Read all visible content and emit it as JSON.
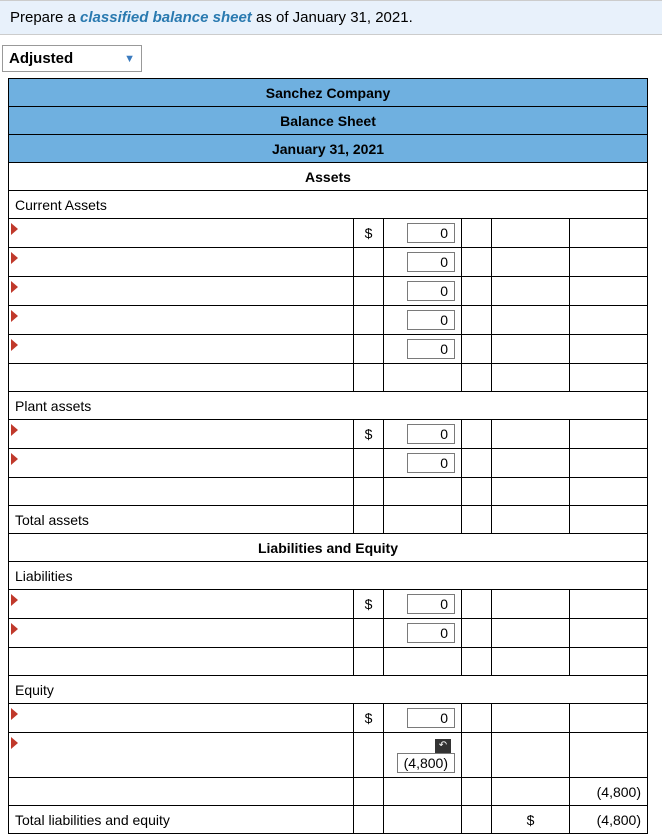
{
  "instruction": {
    "prefix": "Prepare a ",
    "emph": "classified balance sheet",
    "suffix": " as of January 31, 2021."
  },
  "dropdown": {
    "label": "Adjusted"
  },
  "titles": {
    "company": "Sanchez Company",
    "report": "Balance Sheet",
    "date": "January 31, 2021",
    "assets": "Assets",
    "liab_eq": "Liabilities and Equity"
  },
  "sections": {
    "current_assets": "Current Assets",
    "plant_assets": "Plant assets",
    "total_assets": "Total assets",
    "liabilities": "Liabilities",
    "equity": "Equity",
    "total_liab_eq": "Total liabilities and equity"
  },
  "rows": {
    "ca": [
      {
        "curr": "$",
        "val": "0"
      },
      {
        "curr": "",
        "val": "0"
      },
      {
        "curr": "",
        "val": "0"
      },
      {
        "curr": "",
        "val": "0"
      },
      {
        "curr": "",
        "val": "0"
      }
    ],
    "pa": [
      {
        "curr": "$",
        "val": "0"
      },
      {
        "curr": "",
        "val": "0"
      }
    ],
    "liab": [
      {
        "curr": "$",
        "val": "0"
      },
      {
        "curr": "",
        "val": "0"
      }
    ],
    "eq": [
      {
        "curr": "$",
        "val": "0"
      },
      {
        "curr": "",
        "val": "(4,800)",
        "undo": true
      }
    ]
  },
  "totals": {
    "eq_sub": {
      "val3": "(4,800)"
    },
    "grand": {
      "curr3": "$",
      "val3": "(4,800)"
    }
  }
}
